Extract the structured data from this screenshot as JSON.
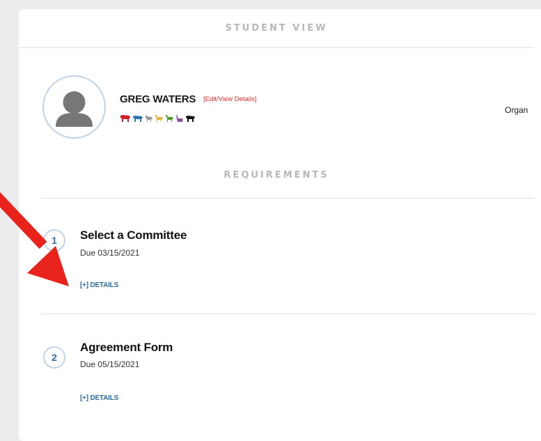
{
  "header": {
    "title": "STUDENT VIEW"
  },
  "student": {
    "name": "GREG WATERS",
    "edit_link": "[Edit/View Details]",
    "animal_icons": [
      {
        "name": "cattle-icon",
        "color": "#d01f2a"
      },
      {
        "name": "dairy-cow-icon",
        "color": "#2f76b4"
      },
      {
        "name": "goat-icon",
        "color": "#9a9a9a"
      },
      {
        "name": "horse-icon",
        "color": "#e2b23a"
      },
      {
        "name": "sheep-icon",
        "color": "#4b9c2c"
      },
      {
        "name": "rabbit-icon",
        "color": "#8e4ea0"
      },
      {
        "name": "pig-icon",
        "color": "#111111"
      }
    ],
    "org_text": "Organ"
  },
  "requirements": {
    "title": "REQUIREMENTS",
    "items": [
      {
        "number": "1",
        "name": "Select a Committee",
        "due": "Due 03/15/2021",
        "details_label": "[+] DETAILS"
      },
      {
        "number": "2",
        "name": "Agreement Form",
        "due": "Due 05/15/2021",
        "details_label": "[+] DETAILS"
      }
    ]
  },
  "colors": {
    "accent_blue": "#2f6ea3",
    "annotation_arrow": "#e8231c",
    "link_red": "#e0282a"
  }
}
